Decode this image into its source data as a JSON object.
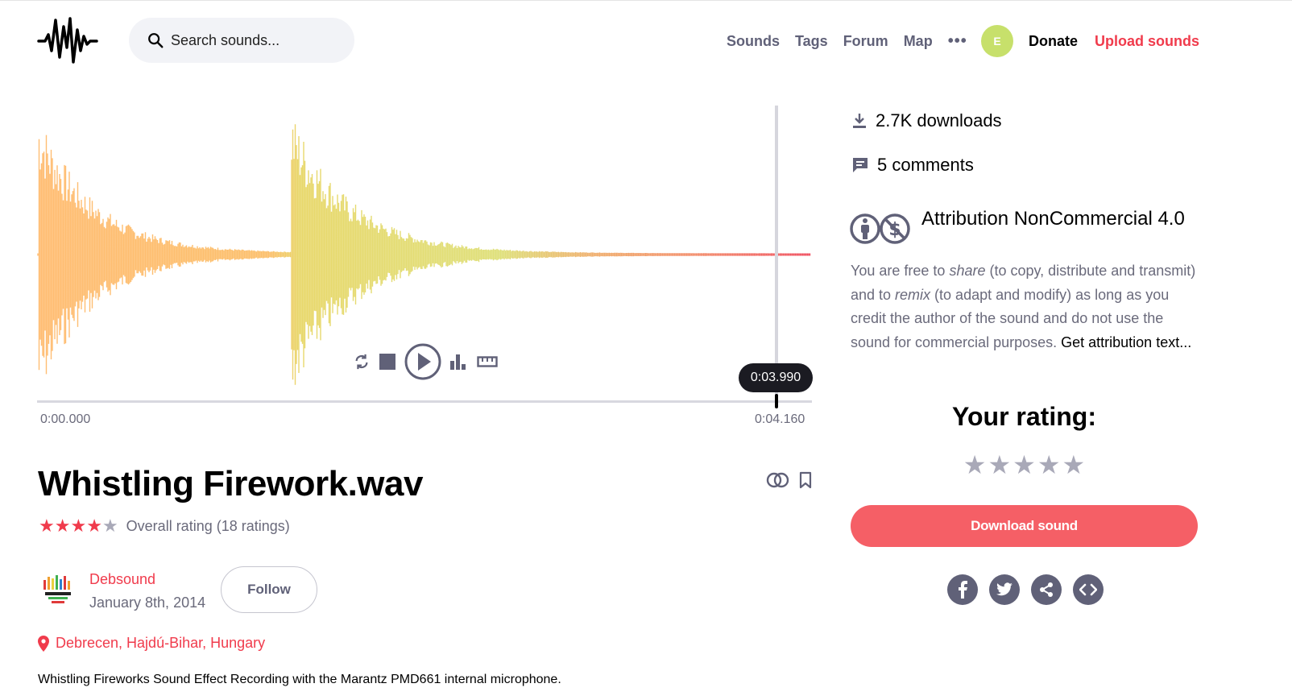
{
  "header": {
    "search_placeholder": "Search sounds...",
    "nav": [
      {
        "label": "Sounds"
      },
      {
        "label": "Tags"
      },
      {
        "label": "Forum"
      },
      {
        "label": "Map"
      }
    ],
    "more": "•••",
    "avatar_initial": "E",
    "donate": "Donate",
    "upload": "Upload sounds"
  },
  "player": {
    "current_time": "0:03.990",
    "start_time": "0:00.000",
    "end_time": "0:04.160",
    "progress": 0.959
  },
  "sound": {
    "title": "Whistling Firework.wav",
    "rating_stars": 4,
    "rating_label": "Overall rating (18 ratings)",
    "username": "Debsound",
    "date": "January 8th, 2014",
    "follow": "Follow",
    "location": "Debrecen, Hajdú-Bihar, Hungary",
    "description": "Whistling Fireworks Sound Effect Recording with the Marantz PMD661 internal microphone."
  },
  "sidebar": {
    "downloads": "2.7K downloads",
    "comments": "5 comments",
    "license_name": "Attribution NonCommercial 4.0",
    "license_text_1": "You are free to ",
    "license_share": "share",
    "license_text_2": " (to copy, distribute and transmit) and to ",
    "license_remix": "remix",
    "license_text_3": " (to adapt and modify) as long as you credit the author of the sound and do not use the sound for commercial purposes. ",
    "license_link": "Get attribution text...",
    "your_rating": "Your rating:",
    "download_button": "Download sound",
    "share_icons": [
      "facebook-icon",
      "twitter-icon",
      "share-icon",
      "embed-icon"
    ]
  },
  "colors": {
    "accent": "#f03b4c",
    "download": "#f55f66",
    "muted": "#606178",
    "wave_start": "#ffbd73",
    "wave_mid": "#e6d86c"
  }
}
